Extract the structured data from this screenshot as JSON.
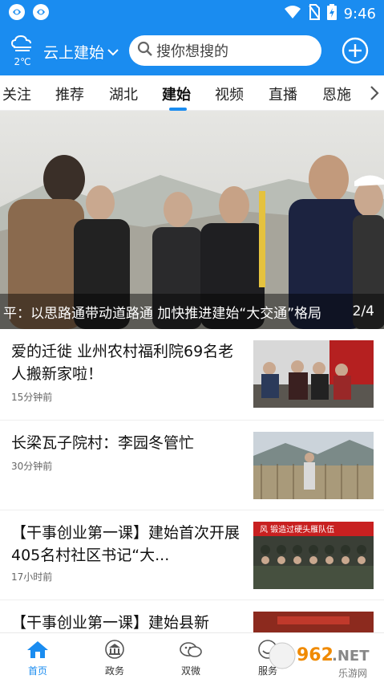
{
  "status": {
    "time": "9:46"
  },
  "header": {
    "temperature": "2℃",
    "location": "云上建始",
    "search_placeholder": "搜你想搜的"
  },
  "tabs": [
    "关注",
    "推荐",
    "湖北",
    "建始",
    "视频",
    "直播",
    "恩施"
  ],
  "active_tab": "建始",
  "banner": {
    "caption": "平：以思路通带动道路通 加快推进建始“大交通”格局",
    "index": "2/4"
  },
  "news": [
    {
      "title": "爱的迁徙 业州农村福利院69名老人搬新家啦！",
      "time": "15分钟前"
    },
    {
      "title": "长梁瓦子院村：李园冬管忙",
      "time": "30分钟前"
    },
    {
      "title": "【干事创业第一课】建始首次开展405名村社区书记“大...",
      "time": "17小时前"
    },
    {
      "title": "【干事创业第一课】建始县新",
      "time": ""
    }
  ],
  "thumb_texts": {
    "item3_banner": "风 锻造过硬头雁队伍"
  },
  "bottom_nav": [
    "首页",
    "政务",
    "双微",
    "服务"
  ],
  "watermark": "962.NET 乐游网",
  "colors": {
    "brand": "#1a8cf0"
  }
}
